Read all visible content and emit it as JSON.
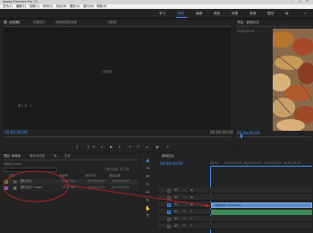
{
  "app": {
    "title": "Adobe Premiere Pro CC"
  },
  "menu": {
    "items": [
      "文件(F)",
      "编辑(E)",
      "剪辑(C)",
      "序列(S)",
      "标记(M)",
      "图形(G)",
      "窗口(W)",
      "帮助(H)"
    ]
  },
  "workspaces": {
    "items": [
      "学习",
      "组件",
      "编辑",
      "颜色",
      "效果",
      "音频",
      "图形",
      "库"
    ]
  },
  "source_panel": {
    "tabs": [
      "源: (无剪辑)",
      "效果控件",
      "音频剪辑混合器",
      "元数据"
    ],
    "overlay_label": "(无剪辑)",
    "timecode_left": "00;00;00;00",
    "timecode_right": "00;00;00;00",
    "page_label": "第 1 页"
  },
  "program_panel": {
    "tab": "节目: 【风光片】",
    "sub_label": "00;00;00;00",
    "timecode": "00;00;00;00"
  },
  "project_panel": {
    "tabs": [
      "项目: 未命名",
      "媒体浏览器",
      "库",
      "信息"
    ],
    "path": "未命名.prproj",
    "search_placeholder": "",
    "item_count": "1 项已选择, 共 2 项",
    "columns": [
      "名称",
      "帧速率",
      "媒体开始",
      "媒体结束"
    ],
    "rows": [
      {
        "name": "【风光片】",
        "rate": "29.97 fps",
        "start": "00;00;00;00",
        "end": "00;00;09;29"
      },
      {
        "name": "【风光片】1.mp4",
        "rate": "29.97 fps",
        "start": "00;00;00;00",
        "end": "00;00;09;29"
      }
    ]
  },
  "timeline": {
    "tab": "【风光片】",
    "timecode": "00;00;00;00",
    "ruler": [
      "00;00",
      "00;00;04;29",
      "00;00;09;29",
      "00;00;14;29",
      "00;00;19;29"
    ],
    "tracks": [
      "V3",
      "V2",
      "V1",
      "A1",
      "A2",
      "A3"
    ],
    "clip_label": "【风光片】1.mp4 [V]"
  },
  "colors": {
    "accent": "#3d8eff",
    "clip": "#5a8ac8",
    "annotation": "#d61e1e"
  }
}
